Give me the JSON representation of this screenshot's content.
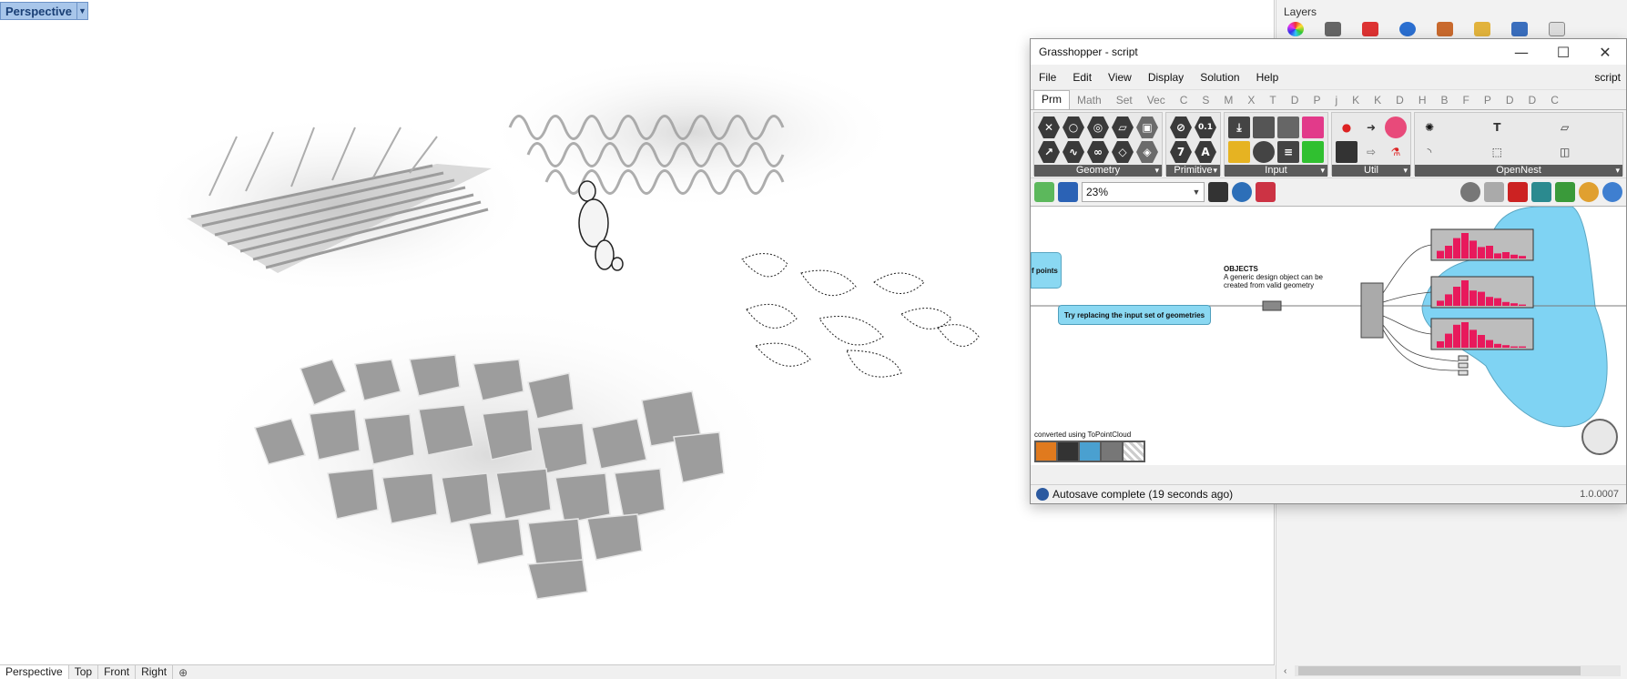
{
  "viewport": {
    "title": "Perspective",
    "tabs": [
      "Perspective",
      "Top",
      "Front",
      "Right"
    ]
  },
  "right_panel": {
    "title": "Layers"
  },
  "grasshopper": {
    "title": "Grasshopper - script",
    "menu": [
      "File",
      "Edit",
      "View",
      "Display",
      "Solution",
      "Help"
    ],
    "menu_right": "script",
    "tabs": [
      "Prm",
      "Math",
      "Set",
      "Vec",
      "C",
      "S",
      "M",
      "X",
      "T",
      "D",
      "P",
      "j",
      "K",
      "K",
      "D",
      "H",
      "B",
      "F",
      "P",
      "D",
      "D",
      "C"
    ],
    "groups": [
      {
        "label": "Geometry",
        "icons": [
          "x-icon",
          "circle-icon",
          "rings-icon",
          "surface-icon",
          "cube-icon",
          "arrow-icon",
          "curve-icon",
          "link-icon",
          "diamond-icon",
          "mesh-icon"
        ]
      },
      {
        "label": "Primitive",
        "icons": [
          "angle-icon",
          "number-icon",
          "seven-icon",
          "text-icon"
        ]
      },
      {
        "label": "Input",
        "icons": [
          "download-icon",
          "battery-icon",
          "slider-icon",
          "toggle-icon",
          "graph-icon",
          "knob-icon",
          "list-icon",
          "colour-icon"
        ]
      },
      {
        "label": "Util",
        "icons": [
          "cherries-icon",
          "tree-icon",
          "arrow-right-icon",
          "arrow-outline-icon",
          "gauge-icon",
          "flask-icon"
        ]
      },
      {
        "label": "OpenNest",
        "icons": [
          "nest-icon",
          "signal-icon",
          "t-icon",
          "eraser-icon",
          "plane-icon",
          "shapes-icon"
        ]
      }
    ],
    "group_numbers": {
      "number": "0.1",
      "seven": "7",
      "text": "A"
    },
    "zoom": "23%",
    "canvas": {
      "points_label": "f points",
      "try_label": "Try replacing the input set of geometries",
      "objects_title": "OBJECTS",
      "objects_desc": "A generic design object can be created from valid geometry",
      "converted": "converted using ToPointCloud"
    },
    "status": "Autosave complete (19 seconds ago)",
    "version": "1.0.0007",
    "colors": {
      "node": "#8ad8f2",
      "group_bg": "#7fd3f3",
      "bars": "#e8195c"
    }
  }
}
